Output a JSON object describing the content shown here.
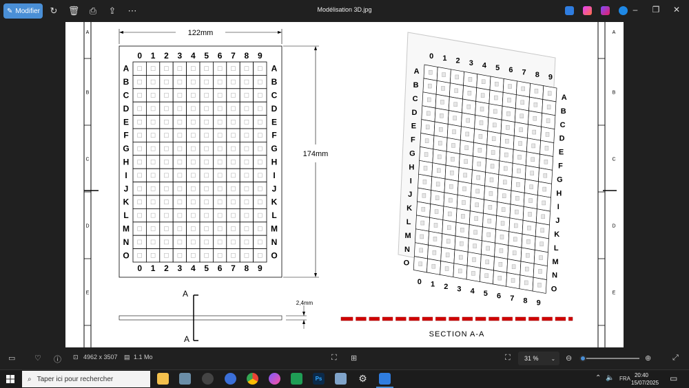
{
  "toolbar": {
    "modify_label": "Modifier",
    "title": "Modélisation 3D.jpg"
  },
  "drawing": {
    "width_dim": "122mm",
    "height_dim": "174mm",
    "thickness_dim": "2,4mm",
    "section_label": "SECTION A-A",
    "section_marker": "A",
    "columns": [
      "0",
      "1",
      "2",
      "3",
      "4",
      "5",
      "6",
      "7",
      "8",
      "9"
    ],
    "rows": [
      "A",
      "B",
      "C",
      "D",
      "E",
      "F",
      "G",
      "H",
      "I",
      "J",
      "K",
      "L",
      "M",
      "N",
      "O"
    ],
    "frame_zones": [
      "A",
      "B",
      "C",
      "D",
      "E"
    ]
  },
  "status": {
    "dimensions": "4962 x 3507",
    "size": "1.1 Mo",
    "zoom": "31 %",
    "zoom_fraction": 0.04
  },
  "taskbar": {
    "search_placeholder": "Taper ici pour rechercher",
    "lang": "FRA",
    "time": "20:40",
    "date": "15/07/2025"
  },
  "colors": {
    "accent": "#4a8fd6",
    "section_red": "#d10000"
  }
}
